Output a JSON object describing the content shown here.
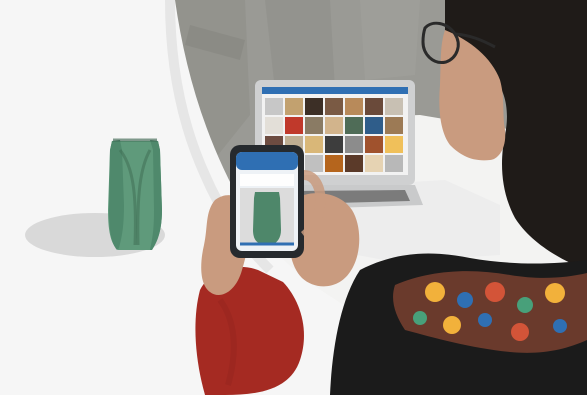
{
  "scene": {
    "colors": {
      "backdrop": "#f3f3f2",
      "wall": "#9a9a95",
      "vase": "#5f9a7b",
      "vase_shadow": "#cfcfcf",
      "laptop_body": "#c9cacb",
      "laptop_screen_bg": "#f2f2f2",
      "phone_body": "#262a2e",
      "phone_ui_blue": "#2f6fb3",
      "sleeve_red": "#a52a22",
      "hair_dark": "#1f1b18",
      "skin": "#c99b7f",
      "tabletop": "#ededed"
    },
    "laptop_gallery_colors": [
      "#c7c7c7",
      "#c2a16f",
      "#3c2f26",
      "#7a5a44",
      "#b88a5a",
      "#6a4a3a",
      "#c8c0b3",
      "#e3dfd8",
      "#c0392b",
      "#8a7b64",
      "#d2b48c",
      "#4f6c57",
      "#2f5d8a",
      "#9c7a55",
      "#6d4c41",
      "#bfae92",
      "#d9b778",
      "#3d3d3d",
      "#8c8c8c",
      "#a0522d",
      "#f0c05a",
      "#7f8c8d",
      "#d7ccc8",
      "#c0c0c0",
      "#b5651d",
      "#5b3a29",
      "#e6d3b3",
      "#b8b8b8"
    ],
    "icons": [
      "vase-icon",
      "phone-icon",
      "laptop-icon",
      "person-icon"
    ]
  }
}
